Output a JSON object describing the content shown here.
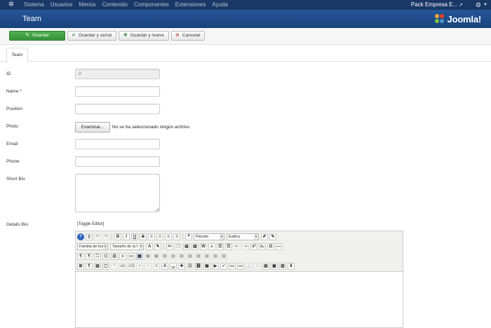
{
  "topbar": {
    "menu": [
      "Sistema",
      "Usuarios",
      "Menús",
      "Contenido",
      "Componentes",
      "Extensiones",
      "Ayuda"
    ],
    "site_name": "Pack Empresa E..."
  },
  "header": {
    "title": "Team",
    "brand": "Joomla!"
  },
  "toolbar": {
    "save": "Guardar",
    "save_close": "Guardar y cerrar",
    "save_new": "Guardar y nuevo",
    "cancel": "Cancelar"
  },
  "tabs": [
    "Team"
  ],
  "form": {
    "id_label": "ID",
    "id_value": "0",
    "name_label": "Name *",
    "position_label": "Position",
    "photo_label": "Photo",
    "file_button": "Examinar...",
    "file_status": "No se ha seleccionado ningún archivo.",
    "email_label": "Email",
    "phone_label": "Phone",
    "short_bio_label": "Short Bio",
    "details_bio_label": "Details Bio"
  },
  "editor": {
    "toggle": "[Toggle Editor]",
    "format_select": "Párrafo",
    "styles_select": "Estilos",
    "font_family_select": "Familia de fue",
    "font_size_select": "Tamaño de la f"
  },
  "colors": {
    "topbar": "#1a3867",
    "header": "#1d4d86",
    "save_button": "#3a9a3f"
  }
}
